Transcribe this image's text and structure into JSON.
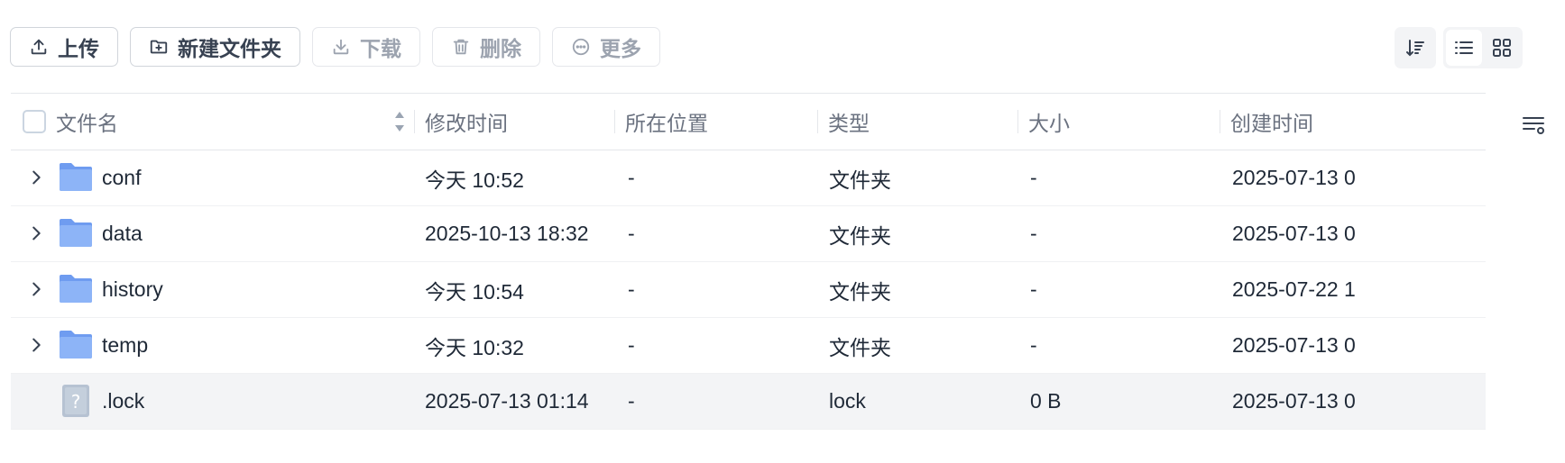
{
  "toolbar": {
    "upload": "上传",
    "new_folder": "新建文件夹",
    "download": "下载",
    "delete": "删除",
    "more": "更多"
  },
  "icons": {
    "upload": "upload-icon",
    "new_folder": "folder-plus-icon",
    "download": "download-icon",
    "delete": "trash-icon",
    "more": "more-circle-icon",
    "sort": "sort-icon",
    "list_view": "list-view-icon",
    "grid_view": "grid-view-icon",
    "column_settings": "column-settings-icon"
  },
  "colors": {
    "accent": "#5b8def",
    "folder": "#7da7f5",
    "unknown_file": "#b6c2d2"
  },
  "columns": [
    "文件名",
    "修改时间",
    "所在位置",
    "类型",
    "大小",
    "创建时间"
  ],
  "rows": [
    {
      "name": "conf",
      "modified": "今天 10:52",
      "location": "-",
      "type": "文件夹",
      "size": "-",
      "created": "2025-07-13 0",
      "kind": "folder"
    },
    {
      "name": "data",
      "modified": "2025-10-13 18:32",
      "location": "-",
      "type": "文件夹",
      "size": "-",
      "created": "2025-07-13 0",
      "kind": "folder"
    },
    {
      "name": "history",
      "modified": "今天 10:54",
      "location": "-",
      "type": "文件夹",
      "size": "-",
      "created": "2025-07-22 1",
      "kind": "folder"
    },
    {
      "name": "temp",
      "modified": "今天 10:32",
      "location": "-",
      "type": "文件夹",
      "size": "-",
      "created": "2025-07-13 0",
      "kind": "folder"
    },
    {
      "name": ".lock",
      "modified": "2025-07-13 01:14",
      "location": "-",
      "type": "lock",
      "size": "0 B",
      "created": "2025-07-13 0",
      "kind": "file"
    }
  ]
}
